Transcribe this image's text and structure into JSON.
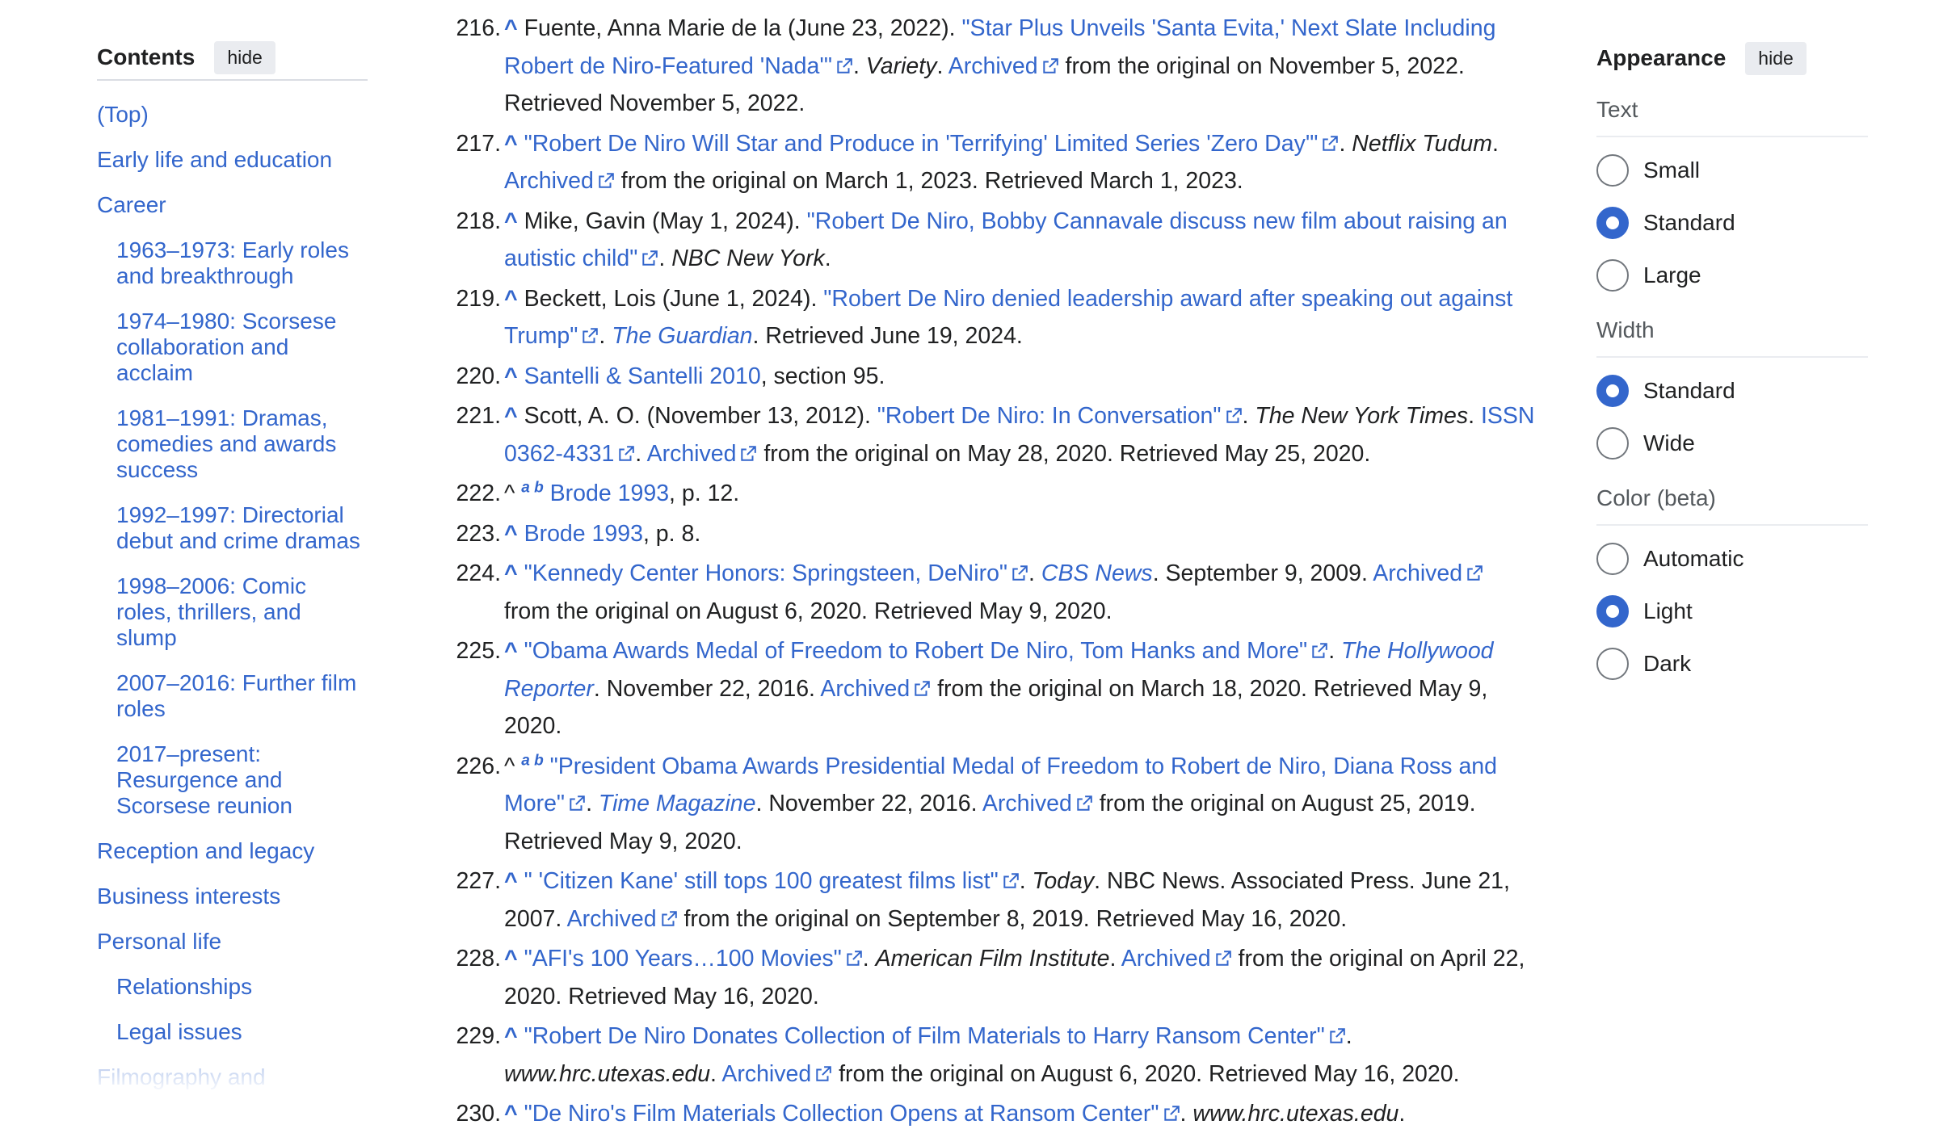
{
  "toc": {
    "title": "Contents",
    "hide_label": "hide",
    "items": [
      {
        "label": "(Top)",
        "level": 1
      },
      {
        "label": "Early life and education",
        "level": 1
      },
      {
        "label": "Career",
        "level": 1,
        "expanded": true
      },
      {
        "label": "1963–1973: Early roles and breakthrough",
        "level": 2
      },
      {
        "label": "1974–1980: Scorsese collaboration and acclaim",
        "level": 2
      },
      {
        "label": "1981–1991: Dramas, comedies and awards success",
        "level": 2
      },
      {
        "label": "1992–1997: Directorial debut and crime dramas",
        "level": 2
      },
      {
        "label": "1998–2006: Comic roles, thrillers, and slump",
        "level": 2
      },
      {
        "label": "2007–2016: Further film roles",
        "level": 2
      },
      {
        "label": "2017–present: Resurgence and Scorsese reunion",
        "level": 2
      },
      {
        "label": "Reception and legacy",
        "level": 1
      },
      {
        "label": "Business interests",
        "level": 1
      },
      {
        "label": "Personal life",
        "level": 1,
        "expanded": true
      },
      {
        "label": "Relationships",
        "level": 2
      },
      {
        "label": "Legal issues",
        "level": 2
      },
      {
        "label": "Filmography and",
        "level": 1
      }
    ]
  },
  "references": [
    {
      "num": "216.",
      "caret": "^",
      "parts": [
        {
          "t": "Fuente, Anna Marie de la (June 23, 2022). "
        },
        {
          "t": "\"Star Plus Unveils 'Santa Evita,' Next Slate Including Robert de Niro-Featured 'Nada'\"",
          "link": true,
          "ext": true
        },
        {
          "t": ". "
        },
        {
          "t": "Variety",
          "i": true
        },
        {
          "t": ". "
        },
        {
          "t": "Archived",
          "link": true,
          "ext": true
        },
        {
          "t": " from the original on November 5, 2022. Retrieved November 5, 2022."
        }
      ]
    },
    {
      "num": "217.",
      "caret": "^",
      "parts": [
        {
          "t": "\"Robert De Niro Will Star and Produce in 'Terrifying' Limited Series 'Zero Day'\"",
          "link": true,
          "ext": true
        },
        {
          "t": ". "
        },
        {
          "t": "Netflix Tudum",
          "i": true
        },
        {
          "t": ". "
        },
        {
          "t": "Archived",
          "link": true,
          "ext": true
        },
        {
          "t": " from the original on March 1, 2023. Retrieved March 1, 2023."
        }
      ]
    },
    {
      "num": "218.",
      "caret": "^",
      "parts": [
        {
          "t": "Mike, Gavin (May 1, 2024). "
        },
        {
          "t": "\"Robert De Niro, Bobby Cannavale discuss new film about raising an autistic child\"",
          "link": true,
          "ext": true
        },
        {
          "t": ". "
        },
        {
          "t": "NBC New York",
          "i": true
        },
        {
          "t": "."
        }
      ]
    },
    {
      "num": "219.",
      "caret": "^",
      "parts": [
        {
          "t": "Beckett, Lois (June 1, 2024). "
        },
        {
          "t": "\"Robert De Niro denied leadership award after speaking out against Trump\"",
          "link": true,
          "ext": true
        },
        {
          "t": ". "
        },
        {
          "t": "The Guardian",
          "i": true,
          "link": true
        },
        {
          "t": ". Retrieved June 19, 2024."
        }
      ]
    },
    {
      "num": "220.",
      "caret": "^",
      "parts": [
        {
          "t": "Santelli & Santelli 2010",
          "link": true
        },
        {
          "t": ", section 95."
        }
      ]
    },
    {
      "num": "221.",
      "caret": "^",
      "parts": [
        {
          "t": "Scott, A. O. (November 13, 2012). "
        },
        {
          "t": "\"Robert De Niro: In Conversation\"",
          "link": true,
          "ext": true
        },
        {
          "t": ". "
        },
        {
          "t": "The New York Times",
          "i": true
        },
        {
          "t": ". "
        },
        {
          "t": "ISSN 0362-4331",
          "link": true,
          "ext": true
        },
        {
          "t": ". "
        },
        {
          "t": "Archived",
          "link": true,
          "ext": true
        },
        {
          "t": " from the original on May 28, 2020. Retrieved May 25, 2020."
        }
      ]
    },
    {
      "num": "222.",
      "caret": "^",
      "caret_plain": true,
      "sup": "a b",
      "parts": [
        {
          "t": "Brode 1993",
          "link": true
        },
        {
          "t": ", p. 12."
        }
      ]
    },
    {
      "num": "223.",
      "caret": "^",
      "parts": [
        {
          "t": "Brode 1993",
          "link": true
        },
        {
          "t": ", p. 8."
        }
      ]
    },
    {
      "num": "224.",
      "caret": "^",
      "parts": [
        {
          "t": "\"Kennedy Center Honors: Springsteen, DeNiro\"",
          "link": true,
          "ext": true
        },
        {
          "t": ". "
        },
        {
          "t": "CBS News",
          "i": true,
          "link": true
        },
        {
          "t": ". September 9, 2009. "
        },
        {
          "t": "Archived",
          "link": true,
          "ext": true
        },
        {
          "t": " from the original on August 6, 2020. Retrieved May 9, 2020."
        }
      ]
    },
    {
      "num": "225.",
      "caret": "^",
      "parts": [
        {
          "t": "\"Obama Awards Medal of Freedom to Robert De Niro, Tom Hanks and More\"",
          "link": true,
          "ext": true
        },
        {
          "t": ". "
        },
        {
          "t": "The Hollywood Reporter",
          "i": true,
          "link": true
        },
        {
          "t": ". November 22, 2016. "
        },
        {
          "t": "Archived",
          "link": true,
          "ext": true
        },
        {
          "t": " from the original on March 18, 2020. Retrieved May 9, 2020."
        }
      ]
    },
    {
      "num": "226.",
      "caret": "^",
      "caret_plain": true,
      "sup": "a b",
      "parts": [
        {
          "t": "\"President Obama Awards Presidential Medal of Freedom to Robert de Niro, Diana Ross and More\"",
          "link": true,
          "ext": true
        },
        {
          "t": ". "
        },
        {
          "t": "Time Magazine",
          "i": true,
          "link": true
        },
        {
          "t": ". November 22, 2016. "
        },
        {
          "t": "Archived",
          "link": true,
          "ext": true
        },
        {
          "t": " from the original on August 25, 2019. Retrieved May 9, 2020."
        }
      ]
    },
    {
      "num": "227.",
      "caret": "^",
      "parts": [
        {
          "t": "\" 'Citizen Kane' still tops 100 greatest films list\"",
          "link": true,
          "ext": true
        },
        {
          "t": ". "
        },
        {
          "t": "Today",
          "i": true
        },
        {
          "t": ". NBC News. Associated Press. June 21, 2007. "
        },
        {
          "t": "Archived",
          "link": true,
          "ext": true
        },
        {
          "t": " from the original on September 8, 2019. Retrieved May 16, 2020."
        }
      ]
    },
    {
      "num": "228.",
      "caret": "^",
      "parts": [
        {
          "t": "\"AFI's 100 Years…100 Movies\"",
          "link": true,
          "ext": true
        },
        {
          "t": ". "
        },
        {
          "t": "American Film Institute",
          "i": true
        },
        {
          "t": ". "
        },
        {
          "t": "Archived",
          "link": true,
          "ext": true
        },
        {
          "t": " from the original on April 22, 2020. Retrieved May 16, 2020."
        }
      ]
    },
    {
      "num": "229.",
      "caret": "^",
      "parts": [
        {
          "t": "\"Robert De Niro Donates Collection of Film Materials to Harry Ransom Center\"",
          "link": true,
          "ext": true
        },
        {
          "t": ". "
        },
        {
          "t": "www.hrc.utexas.edu",
          "i": true
        },
        {
          "t": ". "
        },
        {
          "t": "Archived",
          "link": true,
          "ext": true
        },
        {
          "t": " from the original on August 6, 2020. Retrieved May 16, 2020."
        }
      ]
    },
    {
      "num": "230.",
      "caret": "^",
      "parts": [
        {
          "t": "\"De Niro's Film Materials Collection Opens at Ransom Center\"",
          "link": true,
          "ext": true
        },
        {
          "t": ". "
        },
        {
          "t": "www.hrc.utexas.edu",
          "i": true
        },
        {
          "t": "."
        }
      ]
    }
  ],
  "appearance": {
    "title": "Appearance",
    "hide_label": "hide",
    "groups": [
      {
        "label": "Text",
        "options": [
          {
            "label": "Small",
            "checked": false
          },
          {
            "label": "Standard",
            "checked": true
          },
          {
            "label": "Large",
            "checked": false
          }
        ]
      },
      {
        "label": "Width",
        "options": [
          {
            "label": "Standard",
            "checked": true
          },
          {
            "label": "Wide",
            "checked": false
          }
        ]
      },
      {
        "label": "Color (beta)",
        "options": [
          {
            "label": "Automatic",
            "checked": false
          },
          {
            "label": "Light",
            "checked": true
          },
          {
            "label": "Dark",
            "checked": false
          }
        ]
      }
    ]
  },
  "colors": {
    "link": "#3366cc",
    "text": "#202122",
    "radio_checked": "#3366cc",
    "hide_bg": "#eaecf0"
  },
  "icons": {
    "external_link": "external-link-icon",
    "toc_toggle": "chevron-down-icon"
  }
}
